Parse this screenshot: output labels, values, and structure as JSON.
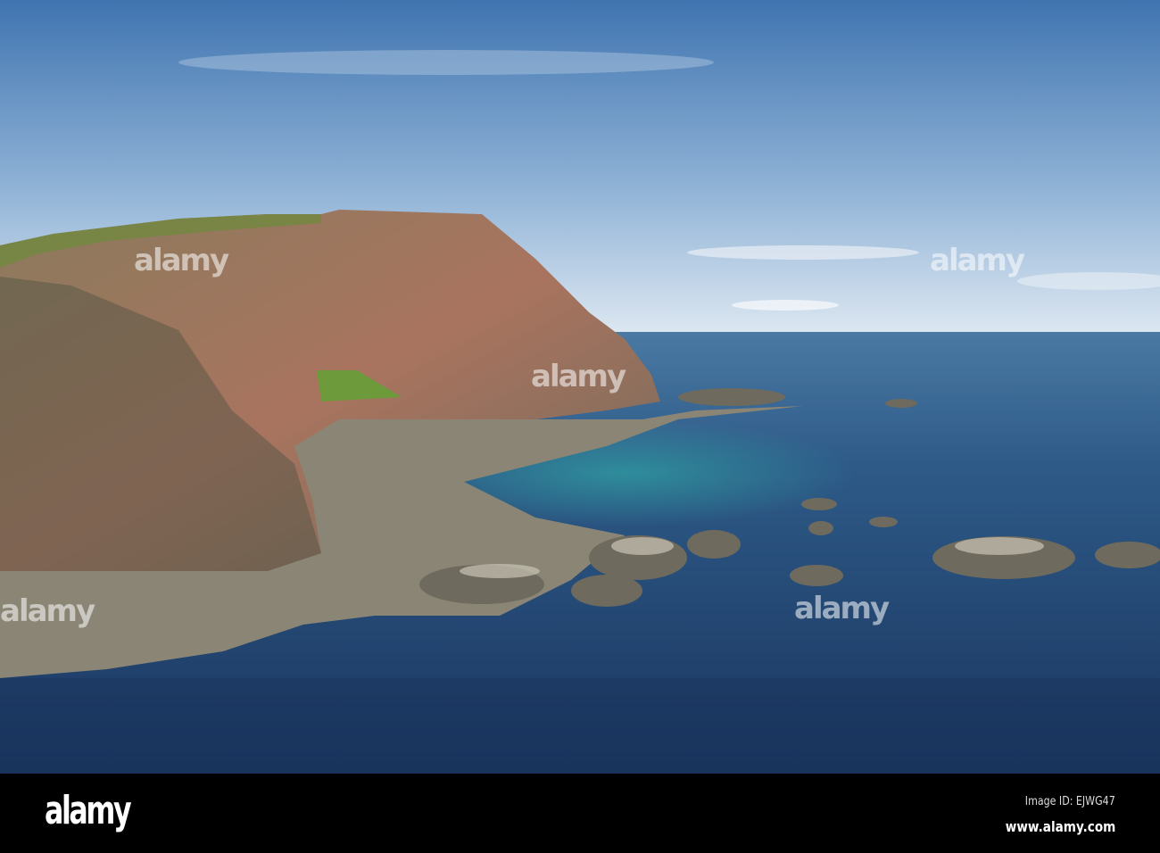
{
  "photo": {
    "subject": "Coastal sea cliffs with rocky shore and blue sea",
    "colors": {
      "sky_top": "#3f74b0",
      "sky_horizon": "#dfe9f2",
      "sea_far": "#3c6f9a",
      "sea_near": "#1d3a63",
      "lagoon": "#2f8c9c",
      "cliff": "#9a6f5e",
      "grass": "#6f8a3e"
    }
  },
  "watermark": {
    "text": "alamy"
  },
  "footer": {
    "logo": "alamy",
    "image_id": "Image ID: EJWG47",
    "site": "www.alamy.com"
  }
}
